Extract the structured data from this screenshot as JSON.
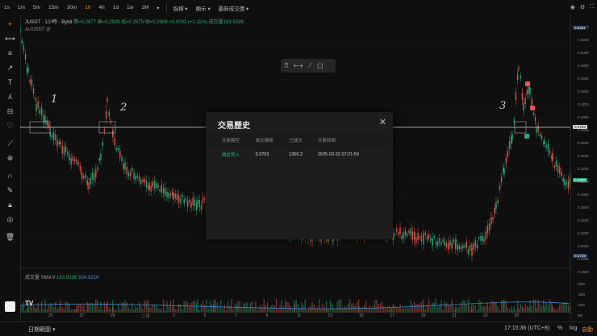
{
  "topbar": {
    "timeframes": [
      "1s",
      "1m",
      "5m",
      "15m",
      "30m",
      "1h",
      "4h",
      "1d",
      "1w",
      "1M"
    ],
    "active_timeframe": "1h",
    "menus": [
      "指標",
      "顯示",
      "最新成交價"
    ]
  },
  "legend": {
    "symbol": "JUSDT · 1小時 · Bybit",
    "open": "開=0.2877",
    "high": "高=0.2929",
    "low": "低=0.2875",
    "close": "收=0.2909",
    "change": "+0.0032 (+1.11%)",
    "volume": "成交量183.502K",
    "secondary_symbol": "AUUSDT"
  },
  "price_axis": {
    "ticks": [
      "0.5400",
      "0.5200",
      "0.5000",
      "0.4800",
      "0.4600",
      "0.4400",
      "0.4200",
      "0.4000",
      "0.3800",
      "0.3600",
      "0.3400",
      "0.3200",
      "0.3000",
      "0.2800",
      "0.2600",
      "0.2400",
      "0.2200",
      "0.2000",
      "0.1800",
      "0.1600"
    ],
    "high_badge_label": "最低價",
    "high_badge_value": "0.5311",
    "line_value": "0.3753",
    "current_value": "0.2909",
    "low_badge_label": "最低價",
    "low_badge_value": "0.1719"
  },
  "volume_axis": [
    "20M",
    "15M",
    "10M",
    "5M"
  ],
  "volume_legend": {
    "label": "成交量 SMA 9",
    "v1": "183.502K",
    "v2": "934.821K"
  },
  "date_axis": [
    "25",
    "27",
    "29",
    "二月",
    "3",
    "5",
    "7",
    "9",
    "11",
    "13",
    "15",
    "17",
    "19",
    "21",
    "23",
    "25"
  ],
  "annotations": [
    "1",
    "2",
    "3"
  ],
  "modal": {
    "title": "交易歷史",
    "headers": [
      "交易類型",
      "成交價格",
      "已成交",
      "交易時間"
    ],
    "rows": [
      {
        "type": "開倉買入",
        "price": "0.3703",
        "filled": "1350.2",
        "time": "2025-02-22 07:21:59"
      }
    ]
  },
  "bottombar": {
    "range_label": "日期範圍",
    "time": "17:15:36 (UTC+8)",
    "percent": "%",
    "log": "log",
    "auto": "自動"
  },
  "colors": {
    "up": "#2aa876",
    "down": "#e0574f",
    "accent": "#e08a2a"
  }
}
